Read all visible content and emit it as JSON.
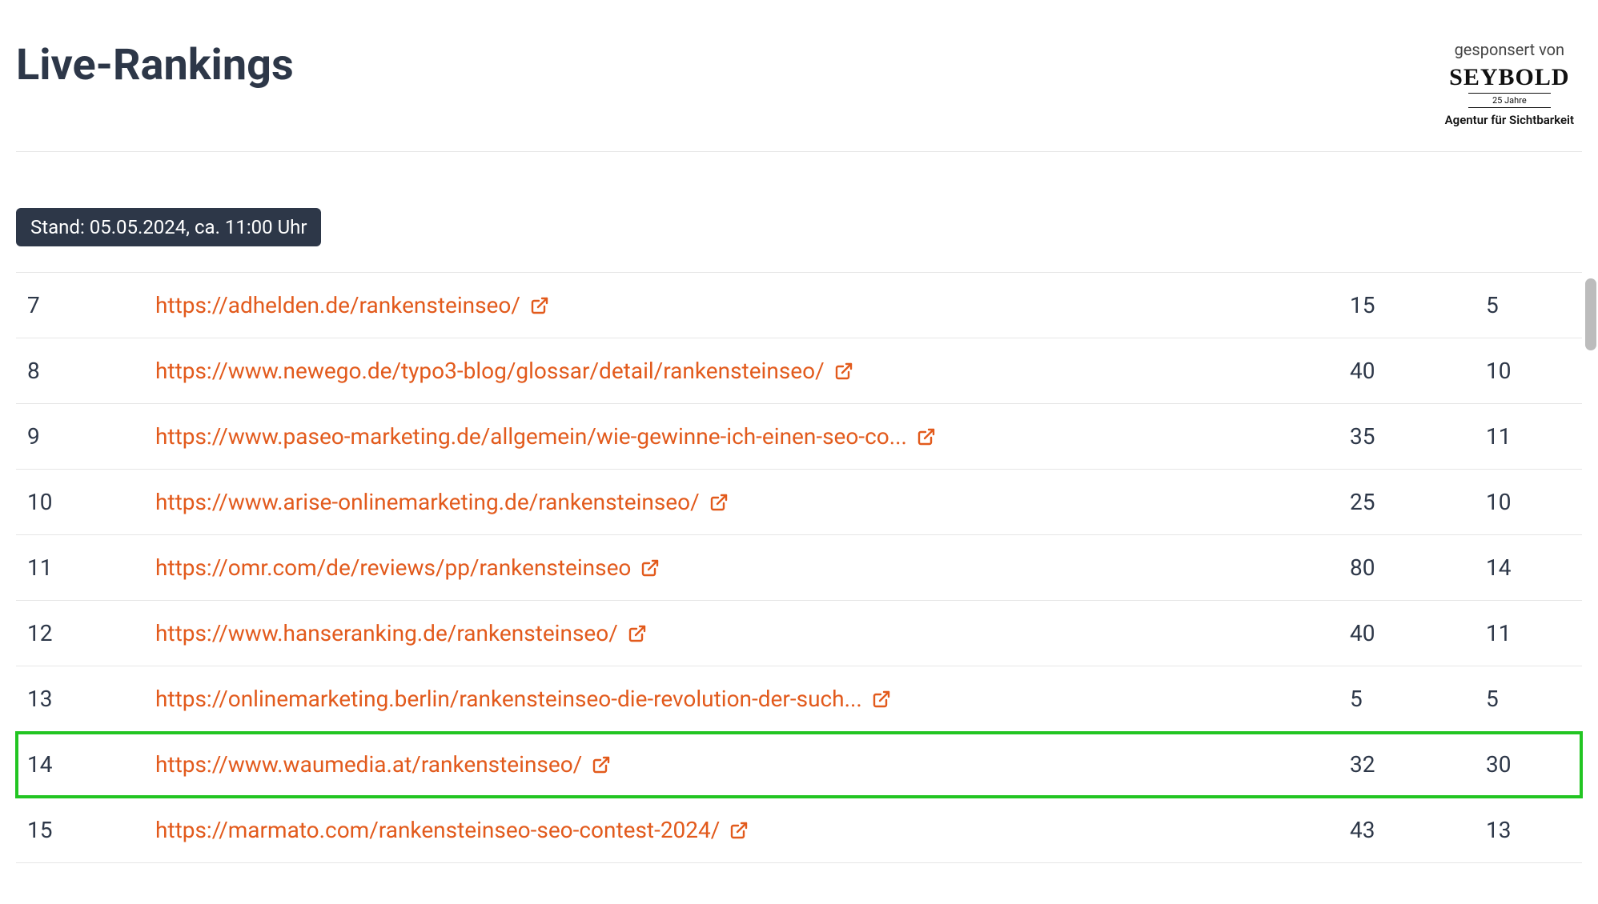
{
  "header": {
    "title": "Live-Rankings",
    "sponsor_label": "gesponsert von",
    "sponsor_logo": "SEYBOLD",
    "sponsor_sub1": "25 Jahre",
    "sponsor_sub2": "Agentur für Sichtbarkeit"
  },
  "status": {
    "text": "Stand: 05.05.2024, ca. 11:00 Uhr"
  },
  "rows": [
    {
      "rank": "7",
      "url": "https://adhelden.de/rankensteinseo/",
      "v1": "15",
      "v2": "5"
    },
    {
      "rank": "8",
      "url": "https://www.newego.de/typo3-blog/glossar/detail/rankensteinseo/",
      "v1": "40",
      "v2": "10"
    },
    {
      "rank": "9",
      "url": "https://www.paseo-marketing.de/allgemein/wie-gewinne-ich-einen-seo-co...",
      "v1": "35",
      "v2": "11"
    },
    {
      "rank": "10",
      "url": "https://www.arise-onlinemarketing.de/rankensteinseo/",
      "v1": "25",
      "v2": "10"
    },
    {
      "rank": "11",
      "url": "https://omr.com/de/reviews/pp/rankensteinseo",
      "v1": "80",
      "v2": "14"
    },
    {
      "rank": "12",
      "url": "https://www.hanseranking.de/rankensteinseo/",
      "v1": "40",
      "v2": "11"
    },
    {
      "rank": "13",
      "url": "https://onlinemarketing.berlin/rankensteinseo-die-revolution-der-such...",
      "v1": "5",
      "v2": "5"
    },
    {
      "rank": "14",
      "url": "https://www.waumedia.at/rankensteinseo/",
      "v1": "32",
      "v2": "30"
    },
    {
      "rank": "15",
      "url": "https://marmato.com/rankensteinseo-seo-contest-2024/",
      "v1": "43",
      "v2": "13"
    }
  ],
  "highlighted_rank": "14"
}
